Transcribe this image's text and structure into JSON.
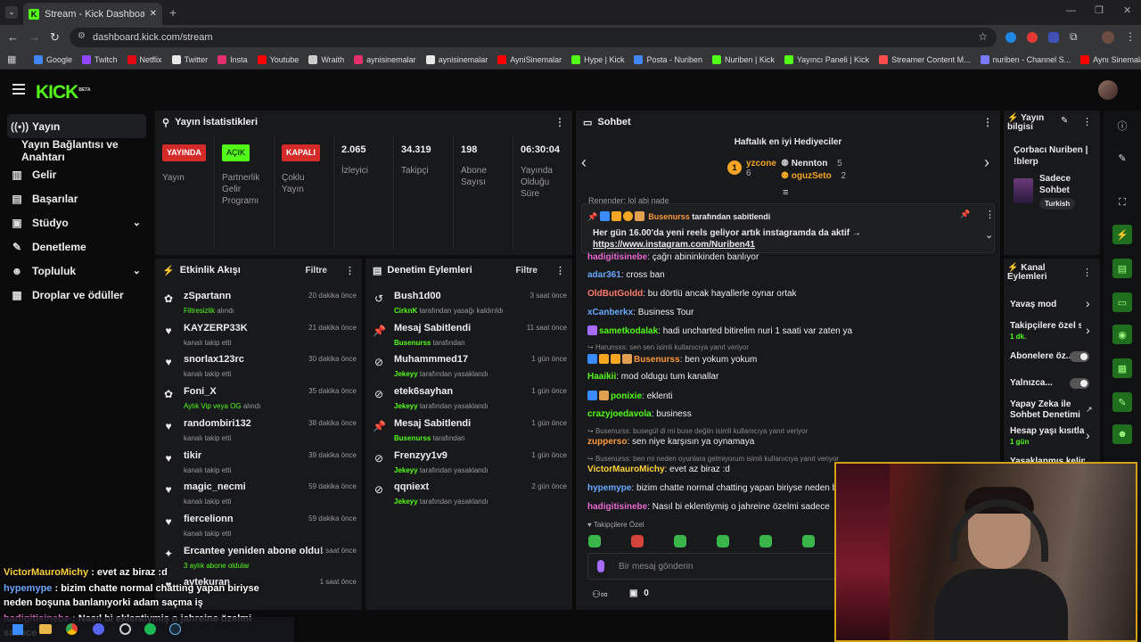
{
  "browser": {
    "tab_title": "Stream - Kick Dashboard",
    "url": "dashboard.kick.com/stream",
    "bookmarks": [
      {
        "label": "Google",
        "color": "#4285f4"
      },
      {
        "label": "Twitch",
        "color": "#9146ff"
      },
      {
        "label": "Netflix",
        "color": "#e50914"
      },
      {
        "label": "Twitter",
        "color": "#e8e8e8"
      },
      {
        "label": "Insta",
        "color": "#e1306c"
      },
      {
        "label": "Youtube",
        "color": "#ff0000"
      },
      {
        "label": "Wraith",
        "color": "#cccccc"
      },
      {
        "label": "aynisinemalar",
        "color": "#e1306c"
      },
      {
        "label": "aynisinemalar",
        "color": "#e8e8e8"
      },
      {
        "label": "AyniSinemalar",
        "color": "#ff0000"
      },
      {
        "label": "Hype | Kick",
        "color": "#53fc18"
      },
      {
        "label": "Posta - Nuriben",
        "color": "#4285f4"
      },
      {
        "label": "Nuriben | Kick",
        "color": "#53fc18"
      },
      {
        "label": "Yayıncı Paneli | Kick",
        "color": "#53fc18"
      },
      {
        "label": "Streamer Content M...",
        "color": "#ff4d4d"
      },
      {
        "label": "nuriben - Channel S...",
        "color": "#7a7aff"
      },
      {
        "label": "Aynı Sinemalar - Ça...",
        "color": "#ff0000"
      }
    ]
  },
  "brand": {
    "logo": "KICK",
    "beta": "BETA",
    "accent": "#53fc18"
  },
  "sidebar": {
    "items": [
      {
        "label": "Yayın"
      },
      {
        "label": "Yayın Bağlantısı ve Anahtarı"
      },
      {
        "label": "Gelir"
      },
      {
        "label": "Başarılar"
      },
      {
        "label": "Stüdyo"
      },
      {
        "label": "Denetleme"
      },
      {
        "label": "Topluluk"
      },
      {
        "label": "Droplar ve ödüller"
      }
    ]
  },
  "stats": {
    "title": "Yayın İstatistikleri",
    "cols": [
      {
        "badge": "YAYINDA",
        "label": "Yayın"
      },
      {
        "badge": "AÇIK",
        "label": "Partnerlik Gelir Programı"
      },
      {
        "badge": "KAPALI",
        "label": "Çoklu Yayın"
      },
      {
        "value": "2.065",
        "label": "İzleyici"
      },
      {
        "value": "34.319",
        "label": "Takipçi"
      },
      {
        "value": "198",
        "label": "Abone Sayısı"
      },
      {
        "value": "06:30:04",
        "label": "Yayında Olduğu Süre"
      }
    ]
  },
  "events": {
    "title": "Etkinlik Akışı",
    "filter": "Filtre",
    "items": [
      {
        "name": "zSpartann",
        "sub_green": "Filtresizlik",
        "sub": " alındı",
        "time": "20 dakika önce",
        "icon": "gift-icon"
      },
      {
        "name": "KAYZERP33K",
        "sub": "kanalı takip etti",
        "time": "21 dakika önce",
        "icon": "heart-icon"
      },
      {
        "name": "snorlax123rc",
        "sub": "kanalı takip etti",
        "time": "30 dakika önce",
        "icon": "heart-icon"
      },
      {
        "name": "Foni_X",
        "sub_green": "Aylık Vip veya OG",
        "sub": " alındı",
        "time": "35 dakika önce",
        "icon": "gift-icon"
      },
      {
        "name": "randombiri132",
        "sub": "kanalı takip etti",
        "time": "38 dakika önce",
        "icon": "heart-icon"
      },
      {
        "name": "tikir",
        "sub": "kanalı takip etti",
        "time": "39 dakika önce",
        "icon": "heart-icon"
      },
      {
        "name": "magic_necmi",
        "sub": "kanalı takip etti",
        "time": "59 dakika önce",
        "icon": "heart-icon"
      },
      {
        "name": "fiercelionn",
        "sub": "kanalı takip etti",
        "time": "59 dakika önce",
        "icon": "heart-icon"
      },
      {
        "name": "Ercantee yeniden abone oldu!",
        "sub_green": "3 aylık abone oldular",
        "sub": "",
        "time": "1 saat önce",
        "icon": "sparkle-icon"
      },
      {
        "name": "aytekuran",
        "sub": "",
        "time": "1 saat önce",
        "icon": "heart-icon"
      }
    ]
  },
  "mod_actions": {
    "title": "Denetim Eylemleri",
    "filter": "Filtre",
    "items": [
      {
        "name": "Bush1d00",
        "by": "CirknK",
        "action": " tarafından yasağı kaldırıldı",
        "time": "3 saat önce",
        "icon": "undo-icon"
      },
      {
        "name": "Mesaj Sabitlendi",
        "by": "Busenurss",
        "action": " tarafından",
        "time": "11 saat önce",
        "icon": "pin-icon"
      },
      {
        "name": "Muhammmed17",
        "by": "Jekeyy",
        "action": " tarafından yasaklandı",
        "time": "1 gün önce",
        "icon": "ban-icon"
      },
      {
        "name": "etek6sayhan",
        "by": "Jekeyy",
        "action": " tarafından yasaklandı",
        "time": "1 gün önce",
        "icon": "ban-icon"
      },
      {
        "name": "Mesaj Sabitlendi",
        "by": "Busenurss",
        "action": " tarafından",
        "time": "1 gün önce",
        "icon": "pin-icon"
      },
      {
        "name": "Frenzyy1v9",
        "by": "Jekeyy",
        "action": " tarafından yasaklandı",
        "time": "1 gün önce",
        "icon": "ban-icon"
      },
      {
        "name": "qqniext",
        "by": "Jekeyy",
        "action": " tarafından yasaklandı",
        "time": "2 gün önce",
        "icon": "ban-icon"
      }
    ]
  },
  "chat": {
    "title": "Sohbet",
    "top_gifters_title": "Haftalık en iyi Hediyeciler",
    "gifters": [
      {
        "name": "yzcone",
        "count": "6",
        "color": "#f5a623"
      },
      {
        "name": "Nennton",
        "count": "5",
        "color": "#e0e0e0"
      },
      {
        "name": "oguzSeto",
        "count": "2",
        "color": "#f5a623"
      }
    ],
    "partial_line": "Renender: lol abi nade",
    "pinned": {
      "by": "Busenurss",
      "by_suffix": " tarafından sabitlendi",
      "text": "Her gün 16.00'da yeni reels geliyor artık instagramda da aktif →",
      "link": "https://www.instagram.com/Nuriben41"
    },
    "messages": [
      {
        "type": "msg",
        "user": "hadigitisinebe",
        "color": "#e86ad0",
        "text": ": çağrı abininkinden banlıyor"
      },
      {
        "type": "msg",
        "user": "adar361",
        "color": "#6aa9ff",
        "text": ": cross ban"
      },
      {
        "type": "msg",
        "user": "OldButGoldd",
        "color": "#ff7a6a",
        "text": ": bu dörtlü ancak hayallerle oynar ortak"
      },
      {
        "type": "msg",
        "user": "xCanberkx",
        "color": "#6aa9ff",
        "text": ": Business Tour"
      },
      {
        "type": "msg",
        "user": "sametkodalak",
        "color": "#53fc18",
        "text": ": hadi uncharted bitirelim nuri 1 saati var zaten ya"
      },
      {
        "type": "reply",
        "text": "Harunsss: sen sen isimli kullanıcıya yanıt veriyor"
      },
      {
        "type": "msg",
        "user": "Busenurss",
        "color": "#ff9a3a",
        "text": ": ben yokum yokum"
      },
      {
        "type": "msg",
        "user": "Haaikii",
        "color": "#53fc18",
        "text": ": mod oldugu tum kanallar"
      },
      {
        "type": "msg",
        "user": "ponixie",
        "color": "#53fc18",
        "text": ": eklenti"
      },
      {
        "type": "msg",
        "user": "crazyjoedavola",
        "color": "#53fc18",
        "text": ": business"
      },
      {
        "type": "reply",
        "text": "Busenurss: busegül di mi buse değiin isimli kullanıcıya yanıt veriyor"
      },
      {
        "type": "msg",
        "user": "zupperso",
        "color": "#ff9a3a",
        "text": ": sen niye karşısın ya oynamaya"
      },
      {
        "type": "reply",
        "text": "Busenurss: ben mi neden oyunlara gelmiyorum isimli kullanıcıya yanıt veriyor"
      },
      {
        "type": "msg",
        "user": "VictorMauroMichy",
        "color": "#ffd23a",
        "text": ": evet az biraz :d"
      },
      {
        "type": "msg",
        "user": "hypemype",
        "color": "#6aa9ff",
        "text": ": bizim chatte normal chatting yapan biriyse neden boşun"
      },
      {
        "type": "msg",
        "user": "hadigitisinebe",
        "color": "#e86ad0",
        "text": ": Nasıl bi eklentiymiş o jahreine özelmi sadece"
      }
    ],
    "followers_only": "Takipçilere Özel",
    "input_placeholder": "Bir mesaj gönderin",
    "points": "0"
  },
  "stream_info": {
    "title": "Yayın bilgisi",
    "stream_title": "Çorbacı Nuriben | !blerp",
    "category": "Sadece Sohbet",
    "language": "Turkish"
  },
  "channel_actions": {
    "title": "Kanal Eylemleri",
    "slow_mode": "Yavaş mod",
    "followers_only": "Takipçilere özel s",
    "followers_only_value": "1 dk.",
    "subs_only": "Abonelere öz...",
    "emotes_only": "Yalnızca...",
    "ai_mod": "Yapay Zeka ile Sohbet Denetimi",
    "account_age": "Hesap yaşı kısıtla",
    "account_age_value": "1 gün",
    "banned_words": "Yasaklanmış kelin"
  },
  "overlay_chat": [
    {
      "user": "VictorMauroMichy",
      "color": "#ffd23a",
      "text": " : evet az biraz :d"
    },
    {
      "user": "hypemype",
      "color": "#6aa9ff",
      "text": " : bizim chatte normal chatting yapan biriyse"
    },
    {
      "user": "",
      "color": "#ffffff",
      "text": "neden boşuna banlanıyorki adam saçma iş"
    },
    {
      "user": "hadigitisinebe",
      "color": "#e86ad0",
      "text": " : Nasıl bi eklentiymiş o jahreine özelmi"
    },
    {
      "user": "",
      "color": "#ffffff",
      "text": "sadece"
    }
  ]
}
